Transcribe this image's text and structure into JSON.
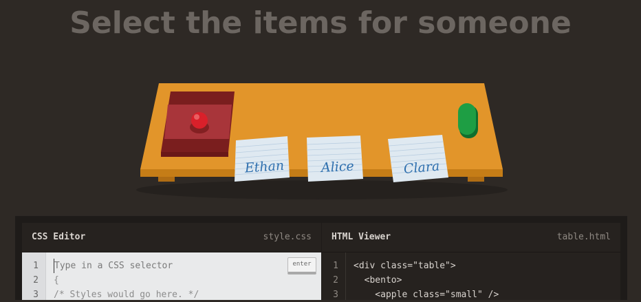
{
  "header": {
    "title": "Select the items for someone"
  },
  "table": {
    "notes": [
      {
        "name": "Ethan"
      },
      {
        "name": "Alice"
      },
      {
        "name": "Clara"
      }
    ],
    "colors": {
      "table": "#e2952a",
      "bento": "#9b2d2d",
      "apple": "#d9202a",
      "pickle": "#1e9e44",
      "note": "#dfe9f1"
    }
  },
  "css_editor": {
    "title": "CSS Editor",
    "file": "style.css",
    "placeholder": "Type in a CSS selector",
    "enter_label": "enter",
    "line_numbers": [
      "1",
      "2",
      "3"
    ],
    "lines": [
      "{",
      "/* Styles would go here. */"
    ]
  },
  "html_viewer": {
    "title": "HTML Viewer",
    "file": "table.html",
    "line_numbers": [
      "1",
      "2",
      "3"
    ],
    "lines": [
      "<div class=\"table\">",
      "  <bento>",
      "    <apple class=\"small\" />"
    ]
  }
}
